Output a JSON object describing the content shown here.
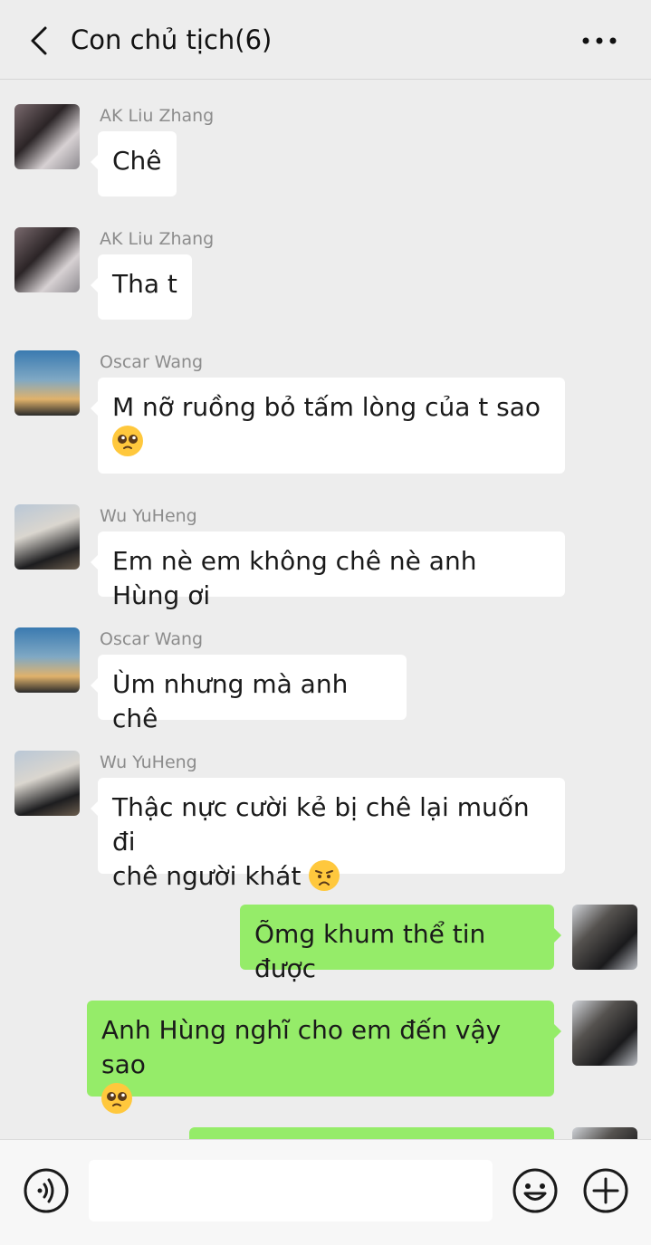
{
  "header": {
    "title": "Con chủ tịch(6)",
    "back_icon": "chevron-left-icon",
    "more_icon": "more-dots-icon"
  },
  "messages": [
    {
      "side": "left",
      "sender": "AK Liu Zhang",
      "line1": "Chê",
      "line2": ""
    },
    {
      "side": "left",
      "sender": "AK Liu Zhang",
      "line1": "Tha t",
      "line2": ""
    },
    {
      "side": "left",
      "sender": "Oscar Wang",
      "line1": "M nỡ ruồng bỏ tấm lòng của t sao",
      "line2": "",
      "emoji_line2": "pleading-face-emoji"
    },
    {
      "side": "left",
      "sender": "Wu YuHeng",
      "line1": "Em nè em không chê nè anh Hùng ơi",
      "line2": ""
    },
    {
      "side": "left",
      "sender": "Oscar Wang",
      "line1": "Ùm nhưng mà anh chê",
      "line2": ""
    },
    {
      "side": "left",
      "sender": "Wu YuHeng",
      "line1": "Thậc nực cười kẻ bị chê lại muốn đi",
      "line2": "chê người khát",
      "emoji_line2": "worried-face-emoji"
    },
    {
      "side": "right",
      "sender": "",
      "line1": "Õmg khum thể tin được",
      "line2": ""
    },
    {
      "side": "right",
      "sender": "",
      "line1": "Anh Hùng nghĩ cho em đến vậy sao",
      "line2": "",
      "emoji_line2": "pleading-face-emoji"
    }
  ],
  "input": {
    "value": "",
    "voice_icon": "voice-icon",
    "emoji_icon": "smiley-icon",
    "plus_icon": "plus-circle-icon"
  },
  "colors": {
    "background": "#ededed",
    "bubble_in": "#ffffff",
    "bubble_out": "#95ec69",
    "sender_text": "#8c8c8c"
  }
}
